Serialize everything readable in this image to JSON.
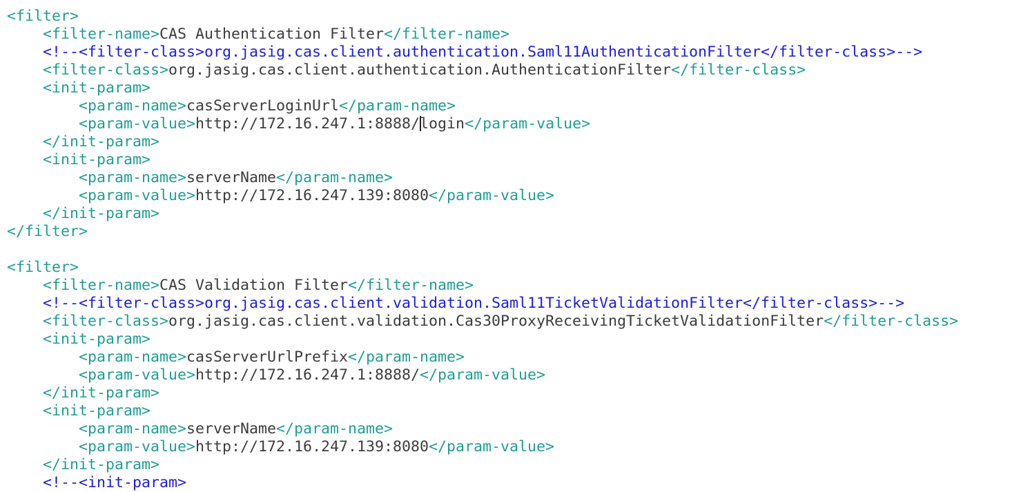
{
  "editor": {
    "colors": {
      "tag": "#1f9e95",
      "comment": "#1d1de0",
      "text": "#3c3c3c"
    },
    "lines": [
      {
        "indent": 0,
        "tokens": [
          {
            "t": "tag",
            "v": "<filter>"
          }
        ]
      },
      {
        "indent": 1,
        "tokens": [
          {
            "t": "tag",
            "v": "<filter-name>"
          },
          {
            "t": "text",
            "v": "CAS Authentication Filter"
          },
          {
            "t": "tag",
            "v": "</filter-name>"
          }
        ]
      },
      {
        "indent": 1,
        "tokens": [
          {
            "t": "comment",
            "v": "<!--<filter-class>org.jasig.cas.client.authentication.Saml11AuthenticationFilter</filter-class>-->"
          }
        ]
      },
      {
        "indent": 1,
        "tokens": [
          {
            "t": "tag",
            "v": "<filter-class>"
          },
          {
            "t": "text",
            "v": "org.jasig.cas.client.authentication.AuthenticationFilter"
          },
          {
            "t": "tag",
            "v": "</filter-class>"
          }
        ]
      },
      {
        "indent": 1,
        "tokens": [
          {
            "t": "tag",
            "v": "<init-param>"
          }
        ]
      },
      {
        "indent": 2,
        "tokens": [
          {
            "t": "tag",
            "v": "<param-name>"
          },
          {
            "t": "text",
            "v": "casServerLoginUrl"
          },
          {
            "t": "tag",
            "v": "</param-name>"
          }
        ]
      },
      {
        "indent": 2,
        "tokens": [
          {
            "t": "tag",
            "v": "<param-value>"
          },
          {
            "t": "text",
            "v": "http://172.16.247.1:8888/"
          },
          {
            "t": "cursor",
            "v": ""
          },
          {
            "t": "text",
            "v": "login"
          },
          {
            "t": "tag",
            "v": "</param-value>"
          }
        ]
      },
      {
        "indent": 1,
        "tokens": [
          {
            "t": "tag",
            "v": "</init-param>"
          }
        ]
      },
      {
        "indent": 1,
        "tokens": [
          {
            "t": "tag",
            "v": "<init-param>"
          }
        ]
      },
      {
        "indent": 2,
        "tokens": [
          {
            "t": "tag",
            "v": "<param-name>"
          },
          {
            "t": "text",
            "v": "serverName"
          },
          {
            "t": "tag",
            "v": "</param-name>"
          }
        ]
      },
      {
        "indent": 2,
        "tokens": [
          {
            "t": "tag",
            "v": "<param-value>"
          },
          {
            "t": "text",
            "v": "http://172.16.247.139:8080"
          },
          {
            "t": "tag",
            "v": "</param-value>"
          }
        ]
      },
      {
        "indent": 1,
        "tokens": [
          {
            "t": "tag",
            "v": "</init-param>"
          }
        ]
      },
      {
        "indent": 0,
        "tokens": [
          {
            "t": "tag",
            "v": "</filter>"
          }
        ]
      },
      {
        "indent": 0,
        "tokens": []
      },
      {
        "indent": 0,
        "tokens": [
          {
            "t": "tag",
            "v": "<filter>"
          }
        ]
      },
      {
        "indent": 1,
        "tokens": [
          {
            "t": "tag",
            "v": "<filter-name>"
          },
          {
            "t": "text",
            "v": "CAS Validation Filter"
          },
          {
            "t": "tag",
            "v": "</filter-name>"
          }
        ]
      },
      {
        "indent": 1,
        "tokens": [
          {
            "t": "comment",
            "v": "<!--<filter-class>org.jasig.cas.client.validation.Saml11TicketValidationFilter</filter-class>-->"
          }
        ]
      },
      {
        "indent": 1,
        "tokens": [
          {
            "t": "tag",
            "v": "<filter-class>"
          },
          {
            "t": "text",
            "v": "org.jasig.cas.client.validation.Cas30ProxyReceivingTicketValidationFilter"
          },
          {
            "t": "tag",
            "v": "</filter-class>"
          }
        ]
      },
      {
        "indent": 1,
        "tokens": [
          {
            "t": "tag",
            "v": "<init-param>"
          }
        ]
      },
      {
        "indent": 2,
        "tokens": [
          {
            "t": "tag",
            "v": "<param-name>"
          },
          {
            "t": "text",
            "v": "casServerUrlPrefix"
          },
          {
            "t": "tag",
            "v": "</param-name>"
          }
        ]
      },
      {
        "indent": 2,
        "tokens": [
          {
            "t": "tag",
            "v": "<param-value>"
          },
          {
            "t": "text",
            "v": "http://172.16.247.1:8888/"
          },
          {
            "t": "tag",
            "v": "</param-value>"
          }
        ]
      },
      {
        "indent": 1,
        "tokens": [
          {
            "t": "tag",
            "v": "</init-param>"
          }
        ]
      },
      {
        "indent": 1,
        "tokens": [
          {
            "t": "tag",
            "v": "<init-param>"
          }
        ]
      },
      {
        "indent": 2,
        "tokens": [
          {
            "t": "tag",
            "v": "<param-name>"
          },
          {
            "t": "text",
            "v": "serverName"
          },
          {
            "t": "tag",
            "v": "</param-name>"
          }
        ]
      },
      {
        "indent": 2,
        "tokens": [
          {
            "t": "tag",
            "v": "<param-value>"
          },
          {
            "t": "text",
            "v": "http://172.16.247.139:8080"
          },
          {
            "t": "tag",
            "v": "</param-value>"
          }
        ]
      },
      {
        "indent": 1,
        "tokens": [
          {
            "t": "tag",
            "v": "</init-param>"
          }
        ]
      },
      {
        "indent": 1,
        "tokens": [
          {
            "t": "comment",
            "v": "<!--<init-param>"
          }
        ]
      }
    ]
  }
}
